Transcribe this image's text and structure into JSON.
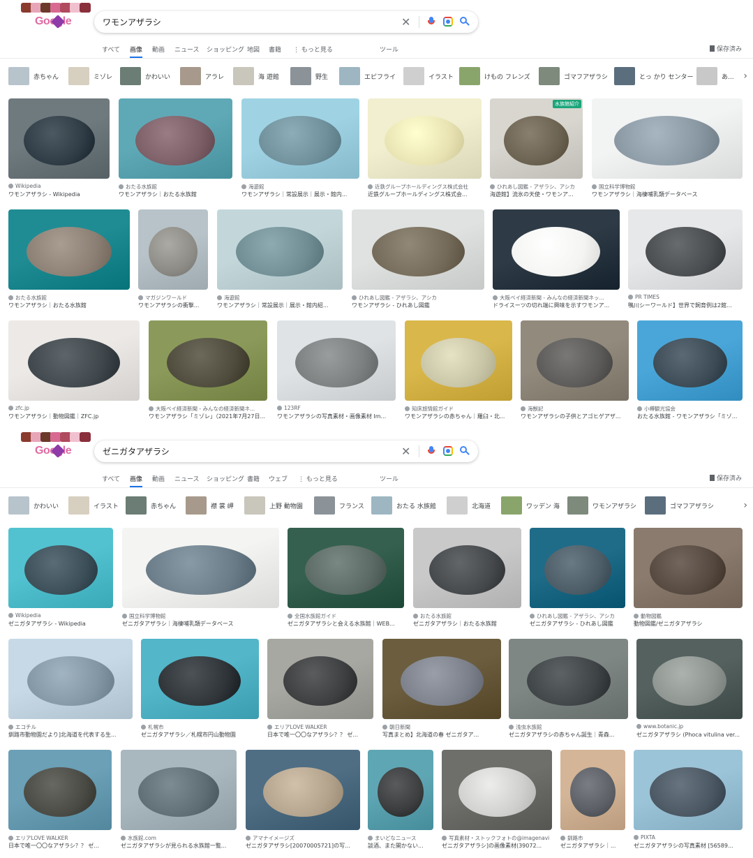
{
  "colors": {
    "accent": "#1a73e8",
    "logo_pink": "#e06aa3"
  },
  "screens": [
    {
      "logo_text": "Google",
      "query": "ワモンアザラシ",
      "tabs": [
        "すべて",
        "画像",
        "動画",
        "ニュース",
        "ショッピング",
        "地図",
        "書籍",
        "⋮ もっと見る",
        "ツール"
      ],
      "active_tab": 1,
      "saved_label": "保存済み",
      "chips": [
        "赤ちゃん",
        "ミゾレ",
        "かわいい",
        "アラレ",
        "海 遊館",
        "野生",
        "エピフライ",
        "イラスト",
        "けもの フレンズ",
        "ゴマフアザラシ",
        "とっ かり センター",
        "あ..."
      ],
      "results": [
        {
          "source": "Wikipedia",
          "title": "ワモンアザラシ - Wikipedia"
        },
        {
          "source": "おたる水族館",
          "title": "ワモンアザラシ｜おたる水族館"
        },
        {
          "source": "海遊館",
          "title": "ワモンアザラシ｜常設展示｜展示・館内..."
        },
        {
          "source": "近鉄グループホールディングス株式会社",
          "title": "近鉄グループホールディングス株式会..."
        },
        {
          "source": "ひれあし図鑑 - アザラシ、アシカ",
          "title": "海遊館】流氷の天使・ワモンア..."
        },
        {
          "source": "国立科学博物館",
          "title": "ワモンアザラシ｜海棲哺乳類データベース"
        },
        {
          "source": "おたる水族館",
          "title": "ワモンアザラシ｜おたる水族館"
        },
        {
          "source": "マガジンワールド",
          "title": "ワモンアザラシの衝撃..."
        },
        {
          "source": "海遊館",
          "title": "ワモンアザラシ｜常設展示｜展示・館内紹..."
        },
        {
          "source": "ひれあし図鑑 - アザラシ、アシカ",
          "title": "ワモンアザラシ - ひれあし図鑑"
        },
        {
          "source": "大阪ベイ経済新聞 - みんなの経済新聞ネッ...",
          "title": "ドライスーツの切れ端に興味を示すワモンア..."
        },
        {
          "source": "PR TIMES",
          "title": "鴨川シーワールド】世界で飼育例は2館..."
        },
        {
          "source": "zfc.jp",
          "title": "ワモンアザラシ｜動物図鑑｜ZFC.jp"
        },
        {
          "source": "大阪ベイ経済新聞 - みんなの経済新聞ネ...",
          "title": "ワモンアザラシ「ミゾレ」（2021年7月27日..."
        },
        {
          "source": "123RF",
          "title": "ワモンアザラシの写真素材・画像素材 Im..."
        },
        {
          "source": "知床旅情館ガイド",
          "title": "ワモンアザラシの赤ちゃん｜羅臼・北..."
        },
        {
          "source": "海獣記",
          "title": "ワモンアザラシの子供とアゴヒゲアザ..."
        },
        {
          "source": "小樽観光協会",
          "title": "おたる水族館 - ワモンアザラシ「ミゾ..."
        }
      ],
      "badge": "水族館紹介"
    },
    {
      "logo_text": "Google",
      "query": "ゼニガタアザラシ",
      "tabs": [
        "すべて",
        "画像",
        "動画",
        "ニュース",
        "ショッピング",
        "書籍",
        "ウェブ",
        "⋮ もっと見る",
        "ツール"
      ],
      "active_tab": 1,
      "saved_label": "保存済み",
      "chips": [
        "かわいい",
        "イラスト",
        "赤ちゃん",
        "襟 裳 岬",
        "上野 動物園",
        "フランス",
        "おたる 水族館",
        "北海道",
        "ワッデン 海",
        "ワモンアザラシ",
        "ゴマフアザラシ"
      ],
      "results": [
        {
          "source": "Wikipedia",
          "title": "ゼニガタアザラシ - Wikipedia"
        },
        {
          "source": "国立科学博物館",
          "title": "ゼニガタアザラシ｜海棲哺乳類データベース"
        },
        {
          "source": "全国水族館ガイド",
          "title": "ゼニガタアザラシと会える水族館｜WEB..."
        },
        {
          "source": "おたる水族館",
          "title": "ゼニガタアザラシ｜おたる水族館"
        },
        {
          "source": "ひれあし図鑑 - アザラシ、アシカ",
          "title": "ゼニガタアザラシ - ひれあし図鑑"
        },
        {
          "source": "動物図鑑",
          "title": "動物図鑑/ゼニガタアザラシ"
        },
        {
          "source": "エコチル",
          "title": "釧路市動物園だより]北海道を代表する生..."
        },
        {
          "source": "札幌市",
          "title": "ゼニガタアザラシ／札幌市円山動物園"
        },
        {
          "source": "エリアLOVE WALKER",
          "title": "日本で唯一〇〇なアザラシ？？ ゼ..."
        },
        {
          "source": "朝日新聞",
          "title": "写真まとめ】北海道の春 ゼニガタア..."
        },
        {
          "source": "浅虫水族館",
          "title": "ゼニガタアザラシの赤ちゃん誕生｜青森..."
        },
        {
          "source": "www.botanic.jp",
          "title": "ゼニガタアザラシ (Phoca vitulina ver..."
        },
        {
          "source": "エリアLOVE WALKER",
          "title": "日本で唯一〇〇なアザラシ？？ ゼ..."
        },
        {
          "source": "水族館.com",
          "title": "ゼニガタアザラシが見られる水族館一覧..."
        },
        {
          "source": "アマナイメージズ",
          "title": "ゼニガタアザラシ[20070005721]の写..."
        },
        {
          "source": "まいどなニュース",
          "title": "談酒、また開かない..."
        },
        {
          "source": "写真素材・ストックフォトの@imagenavi",
          "title": "ゼニガタアザラシ]の画像素材(39072..."
        },
        {
          "source": "釧路市",
          "title": "ゼニガタアザラシ｜..."
        },
        {
          "source": "PIXTA",
          "title": "ゼニガタアザラシの写真素材 [56589..."
        }
      ],
      "badge": ""
    }
  ]
}
